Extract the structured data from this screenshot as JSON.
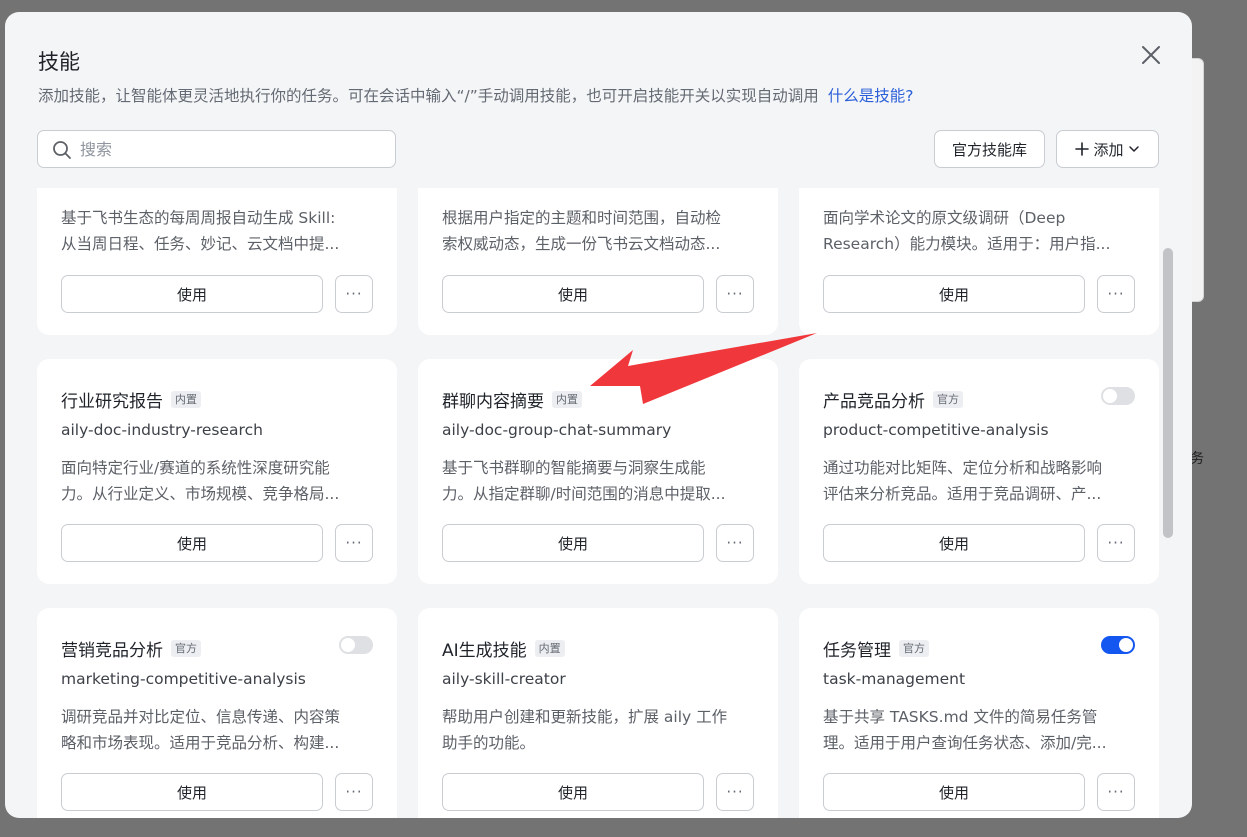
{
  "dialog": {
    "title": "技能",
    "description": "添加技能，让智能体更灵活地执行你的任务。可在会话中输入“/”手动调用技能，也可开启技能开关以实现自动调用",
    "help_link": "什么是技能?"
  },
  "search": {
    "placeholder": "搜索"
  },
  "toolbar": {
    "official_library": "官方技能库",
    "add": "添加"
  },
  "common": {
    "use_label": "使用",
    "more_label": "···"
  },
  "cards": [
    {
      "description_line1": "基于飞书生态的每周周报自动生成 Skill:",
      "description_line2": "从当周日程、任务、妙记、云文档中提..."
    },
    {
      "description_line1": "根据用户指定的主题和时间范围，自动检",
      "description_line2": "索权威动态，生成一份飞书云文档动态..."
    },
    {
      "description_line1": "面向学术论文的原文级调研（Deep",
      "description_line2": "Research）能力模块。适用于：用户指..."
    },
    {
      "name": "行业研究报告",
      "tag": "内置",
      "slug": "aily-doc-industry-research",
      "description_line1": "面向特定行业/赛道的系统性深度研究能",
      "description_line2": "力。从行业定义、市场规模、竞争格局..."
    },
    {
      "name": "群聊内容摘要",
      "tag": "内置",
      "slug": "aily-doc-group-chat-summary",
      "description_line1": "基于飞书群聊的智能摘要与洞察生成能",
      "description_line2": "力。从指定群聊/时间范围的消息中提取..."
    },
    {
      "name": "产品竞品分析",
      "tag": "官方",
      "slug": "product-competitive-analysis",
      "enabled": false,
      "description_line1": "通过功能对比矩阵、定位分析和战略影响",
      "description_line2": "评估来分析竞品。适用于竞品调研、产..."
    },
    {
      "name": "营销竞品分析",
      "tag": "官方",
      "slug": "marketing-competitive-analysis",
      "enabled": false,
      "description_line1": "调研竞品并对比定位、信息传递、内容策",
      "description_line2": "略和市场表现。适用于竞品分析、构建..."
    },
    {
      "name": "AI生成技能",
      "tag": "内置",
      "slug": "aily-skill-creator",
      "description_line1": "帮助用户创建和更新技能，扩展 aily 工作",
      "description_line2": "助手的功能。"
    },
    {
      "name": "任务管理",
      "tag": "官方",
      "slug": "task-management",
      "enabled": true,
      "description_line1": "基于共享 TASKS.md 文件的简易任务管",
      "description_line2": "理。适用于用户查询任务状态、添加/完..."
    }
  ],
  "annotation": {
    "arrow_color": "#f0373b"
  },
  "colors": {
    "accent": "#1456f0",
    "link": "#2b5fd9"
  },
  "background": {
    "edge_glyph": "务"
  }
}
